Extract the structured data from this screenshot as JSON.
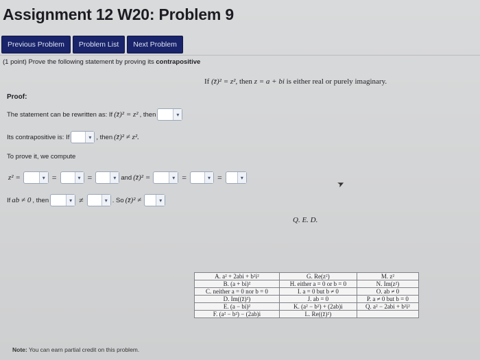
{
  "page": {
    "title": "Assignment 12 W20: Problem 9"
  },
  "nav": {
    "previous": "Previous Problem",
    "list": "Problem List",
    "next": "Next Problem"
  },
  "problem": {
    "points": "(1 point) Prove the following statement by proving its",
    "method": "contrapositive",
    "statement_if": "If",
    "statement_eq": "(z̄)² = z²,",
    "statement_then": "then",
    "statement_z": "z = a + bi",
    "statement_rest": "is either real or purely imaginary."
  },
  "proof": {
    "heading": "Proof:",
    "line1_text": "The statement can be rewritten as: If",
    "line1_eq": "(z̄)² = z²",
    "line1_then": ", then",
    "line2_text": "Its contrapositive is: If",
    "line2_then": ", then",
    "line2_eq": "(z̄)² ≠ z².",
    "line3_text": "To prove it, we compute",
    "line4_z2": "z² =",
    "eq": "=",
    "and": "and",
    "zbar2": "(z̄)² =",
    "line5_text": "If",
    "ab_ne": "ab ≠ 0",
    "line5_then": ", then",
    "neq": "≠",
    "line5_so": ". So",
    "so_zbar2": "(z̄)² ≠",
    "qed": "Q. E. D."
  },
  "choices": [
    [
      "A. a² + 2abi + b²i²",
      "G. Re(z²)",
      "M. z²"
    ],
    [
      "B. (a + bi)²",
      "H. either a = 0 or b = 0",
      "N. Im(z²)"
    ],
    [
      "C. neither a = 0 nor b = 0",
      "I. a = 0 but b ≠ 0",
      "O. ab ≠ 0"
    ],
    [
      "D. Im((z̄)²)",
      "J. ab = 0",
      "P. a ≠ 0 but b = 0"
    ],
    [
      "E. (a − bi)²",
      "K. (a² − b²) + (2ab)i",
      "Q. a² − 2abi + b²i²"
    ],
    [
      "F. (a² − b²) − (2ab)i",
      "L. Re((z̄)²)",
      ""
    ]
  ],
  "footer": {
    "note_label": "Note:",
    "note_text": "You can earn partial credit on this problem."
  },
  "colors": {
    "nav_button": "#19246a",
    "background": "#d9dadb"
  }
}
